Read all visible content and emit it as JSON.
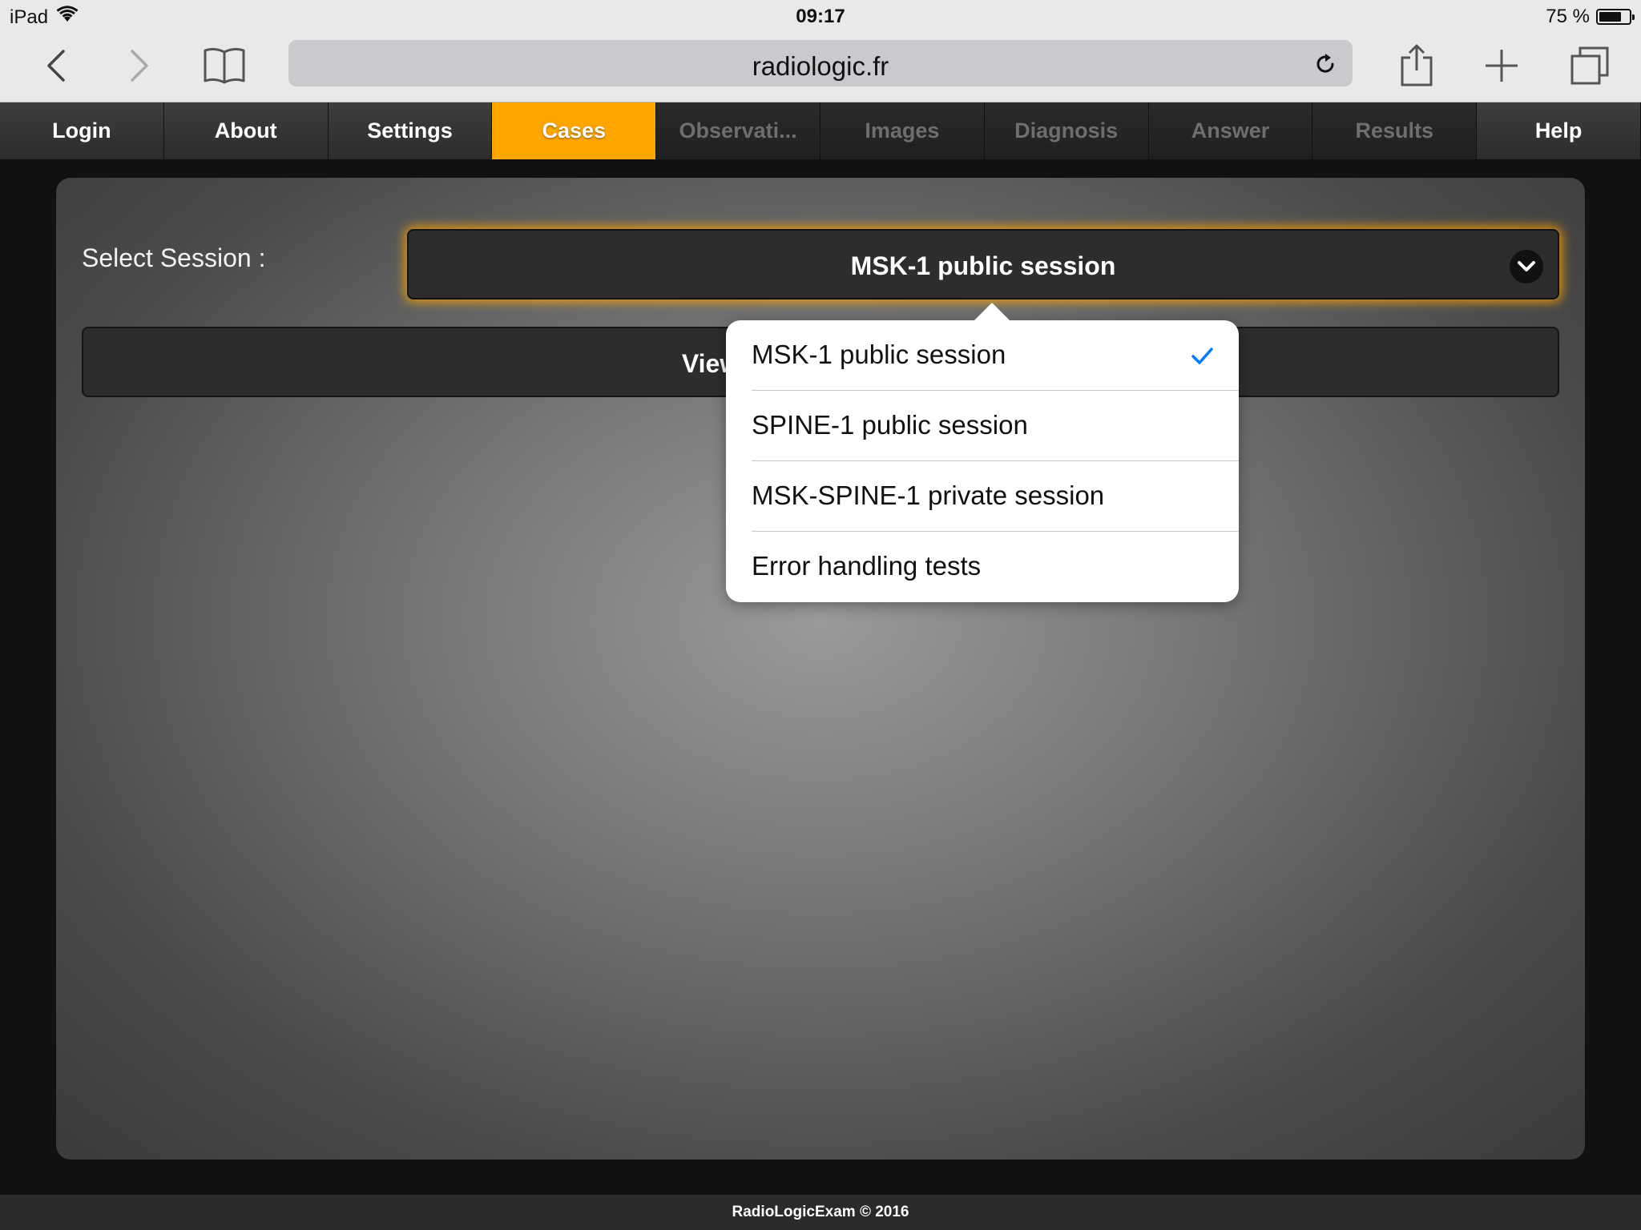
{
  "status_bar": {
    "device": "iPad",
    "wifi_icon": "wifi-icon",
    "time": "09:17",
    "battery_percent": "75 %",
    "battery_level": 0.75
  },
  "browser": {
    "url": "radiologic.fr",
    "icons": {
      "back": "chevron-left-icon",
      "forward": "chevron-right-icon",
      "bookmarks": "book-icon",
      "reload": "reload-icon",
      "share": "share-icon",
      "new_tab": "plus-icon",
      "tabs": "tabs-icon"
    }
  },
  "tabs": [
    {
      "label": "Login",
      "state": "normal"
    },
    {
      "label": "About",
      "state": "normal"
    },
    {
      "label": "Settings",
      "state": "normal"
    },
    {
      "label": "Cases",
      "state": "active"
    },
    {
      "label": "Observati...",
      "state": "disabled"
    },
    {
      "label": "Images",
      "state": "disabled"
    },
    {
      "label": "Diagnosis",
      "state": "disabled"
    },
    {
      "label": "Answer",
      "state": "disabled"
    },
    {
      "label": "Results",
      "state": "disabled"
    },
    {
      "label": "Help",
      "state": "normal"
    }
  ],
  "main": {
    "select_label": "Select Session :",
    "selected_session": "MSK-1 public session",
    "view_button_label": "View selected session,"
  },
  "popover": {
    "options": [
      {
        "label": "MSK-1 public session",
        "checked": true
      },
      {
        "label": "SPINE-1 public session",
        "checked": false
      },
      {
        "label": "MSK-SPINE-1 private session",
        "checked": false
      },
      {
        "label": "Error handling tests",
        "checked": false
      }
    ],
    "check_color": "#007aff"
  },
  "footer": {
    "text": "RadioLogicExam © 2016"
  },
  "colors": {
    "accent": "#ffa500",
    "disabled_text": "#6e6e6e"
  }
}
